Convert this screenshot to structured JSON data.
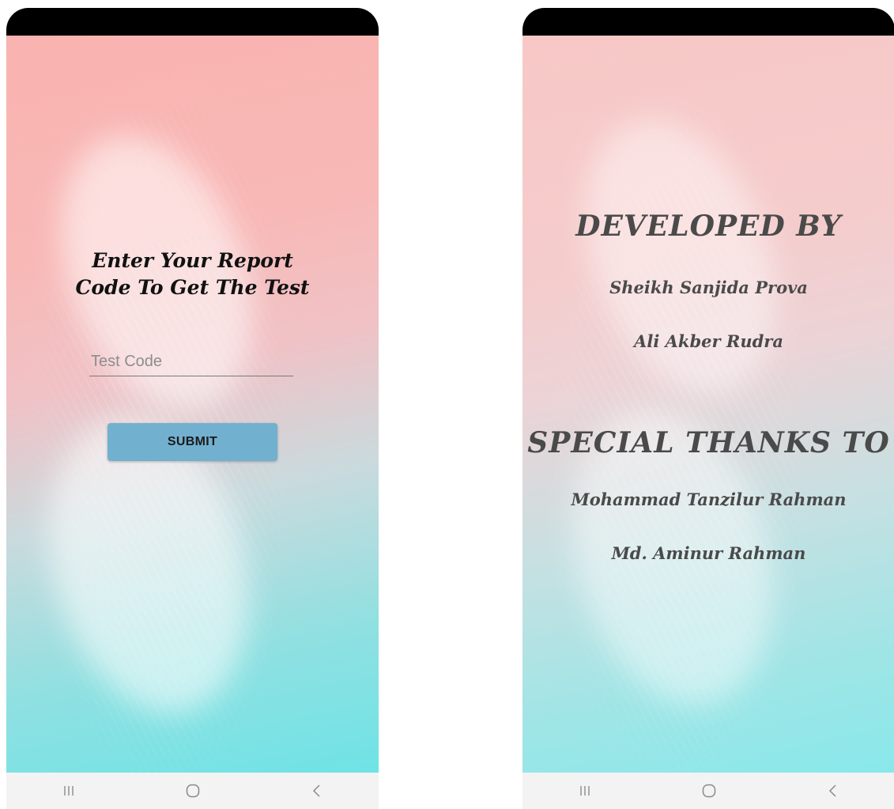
{
  "login_screen": {
    "prompt": "Enter Your Report\nCode To Get The Test",
    "test_code": {
      "value": "",
      "placeholder": "Test Code"
    },
    "submit_label": "SUBMIT"
  },
  "credits_screen": {
    "developed_by_heading": "DEVELOPED BY",
    "developers": [
      "Sheikh Sanjida Prova",
      "Ali Akber Rudra"
    ],
    "special_thanks_heading": "SPECIAL THANKS TO",
    "thanks": [
      "Mohammad Tanzilur Rahman",
      "Md. Aminur Rahman"
    ]
  },
  "navigation": {
    "icons": [
      "recent-apps-icon",
      "home-icon",
      "back-icon"
    ]
  },
  "colors": {
    "status_bar": "#000000",
    "submit_button": "#72b0d0",
    "nav_bar": "#f3f3f3"
  }
}
